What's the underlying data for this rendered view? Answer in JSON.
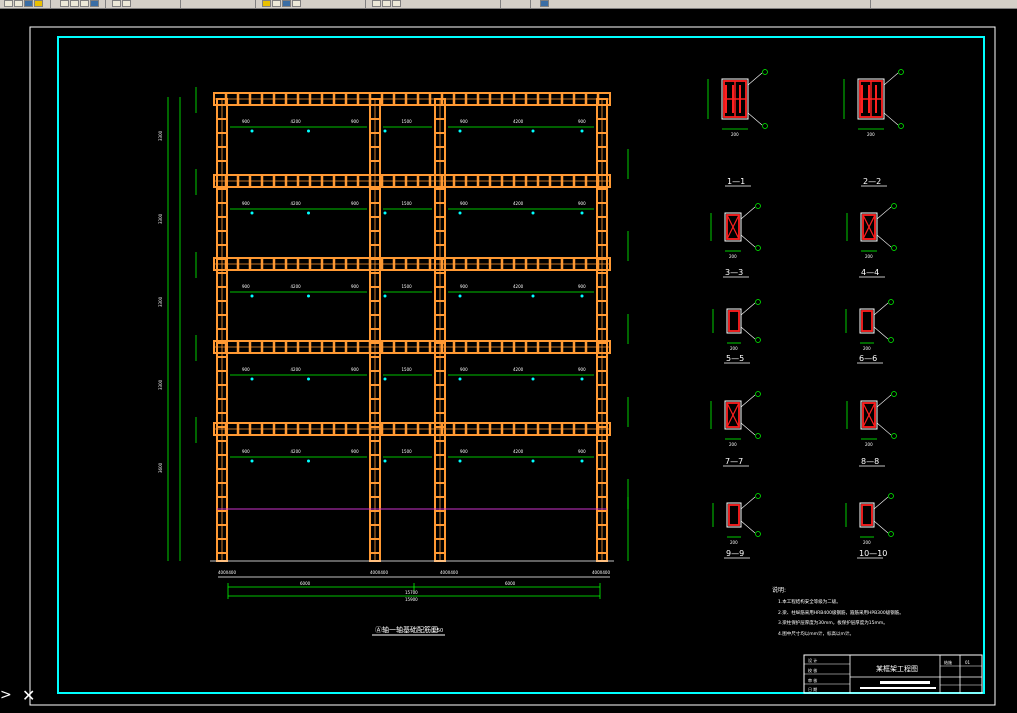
{
  "toolbar": {
    "icons": [
      "new-icon",
      "open-icon",
      "save-icon",
      "print-icon",
      "cut-icon",
      "copy-icon",
      "paste-icon",
      "undo-icon",
      "redo-icon",
      "pan-icon",
      "zoom-realtime-icon",
      "zoom-window-icon",
      "zoom-previous-icon",
      "properties-icon",
      "text-style-icon",
      "layer-icon",
      "color-icon",
      "linetype-icon"
    ]
  },
  "drawing": {
    "main_title": "Ⓐ轴一轴基础配筋图",
    "main_scale": "1:50",
    "dim_total": "15900",
    "dim_sub": "15700",
    "dim_left_span": "6000",
    "dim_right_span": "6000",
    "dim_beam_span": "4200",
    "dim_mid_span": "1500",
    "dim_beam_end": "900",
    "axis_bottom_left": "400X400",
    "axis_bottom_mid1": "400X400",
    "axis_bottom_mid2": "400X400",
    "axis_bottom_right": "400X400",
    "story_heights": [
      "3300",
      "3300",
      "3300",
      "3300",
      "3600"
    ],
    "section_labels": [
      "1—1",
      "2—2",
      "3—3",
      "4—4",
      "5—5",
      "6—6",
      "7—7",
      "8—8",
      "9—9",
      "10—10"
    ],
    "section_dim": "200",
    "notes_title": "说明:",
    "notes": [
      "1.本工程结构安全等级为二级。",
      "2.梁、柱纵筋采用HRB400级钢筋，箍筋采用HPB300级钢筋。",
      "3.梁柱保护层厚度为30mm，板保护层厚度为15mm。",
      "4.图中尺寸均以mm计，标高以m计。"
    ],
    "title_block": {
      "project": "某框架工程图",
      "row1": "设 计",
      "row2": "校 核",
      "row3": "审 核",
      "row4": "日 期",
      "drawing_no": "结施",
      "sheet": "01"
    }
  },
  "colors": {
    "background": "#000000",
    "frame_border": "#00ffff",
    "beam": "#ff9933",
    "column": "#ff9933",
    "rebar": "#ff2020",
    "dimension": "#00ff00",
    "text": "#ffffff",
    "accent_line": "#cc33cc"
  }
}
